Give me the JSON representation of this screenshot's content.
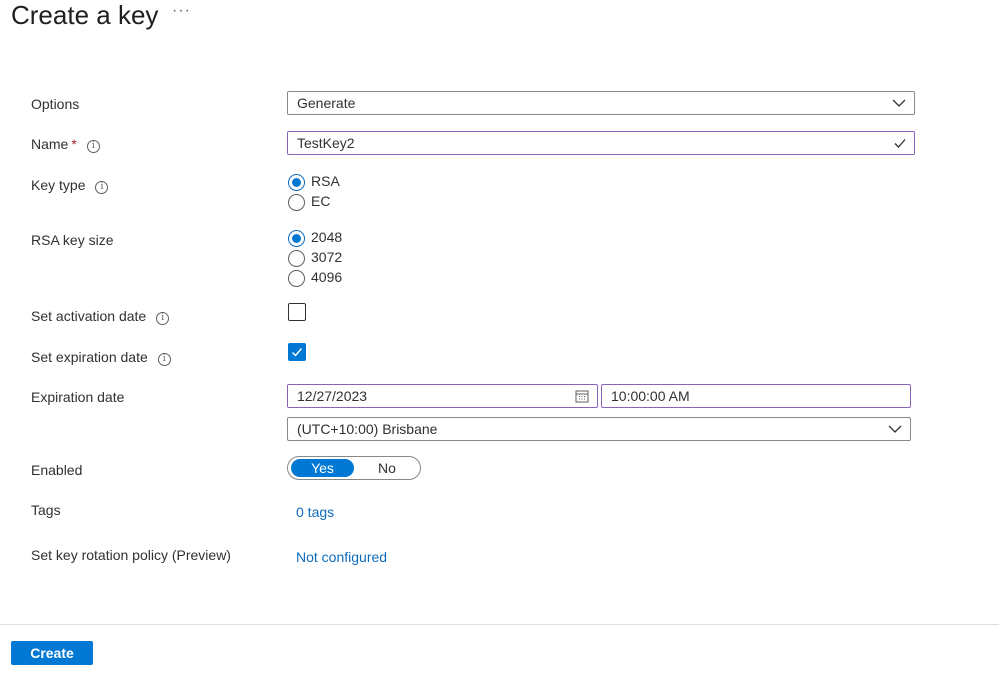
{
  "header": {
    "title": "Create a key",
    "more": "···"
  },
  "form": {
    "options": {
      "label": "Options",
      "value": "Generate"
    },
    "name": {
      "label": "Name",
      "required_mark": "*",
      "value": "TestKey2"
    },
    "key_type": {
      "label": "Key type",
      "options": [
        "RSA",
        "EC"
      ],
      "selected": "RSA"
    },
    "rsa_key_size": {
      "label": "RSA key size",
      "options": [
        "2048",
        "3072",
        "4096"
      ],
      "selected": "2048"
    },
    "activation": {
      "label": "Set activation date",
      "checked": false
    },
    "expiration": {
      "label": "Set expiration date",
      "checked": true
    },
    "expiration_date": {
      "label": "Expiration date",
      "date": "12/27/2023",
      "time": "10:00:00 AM",
      "timezone": "(UTC+10:00) Brisbane"
    },
    "enabled": {
      "label": "Enabled",
      "yes": "Yes",
      "no": "No",
      "selected": "Yes"
    },
    "tags": {
      "label": "Tags",
      "value": "0 tags"
    },
    "rotation": {
      "label": "Set key rotation policy (Preview)",
      "value": "Not configured"
    }
  },
  "footer": {
    "create_label": "Create"
  },
  "colors": {
    "accent": "#0078d4",
    "focus_border": "#8764b8",
    "required": "#a4262c",
    "link": "#0f6cbd"
  }
}
